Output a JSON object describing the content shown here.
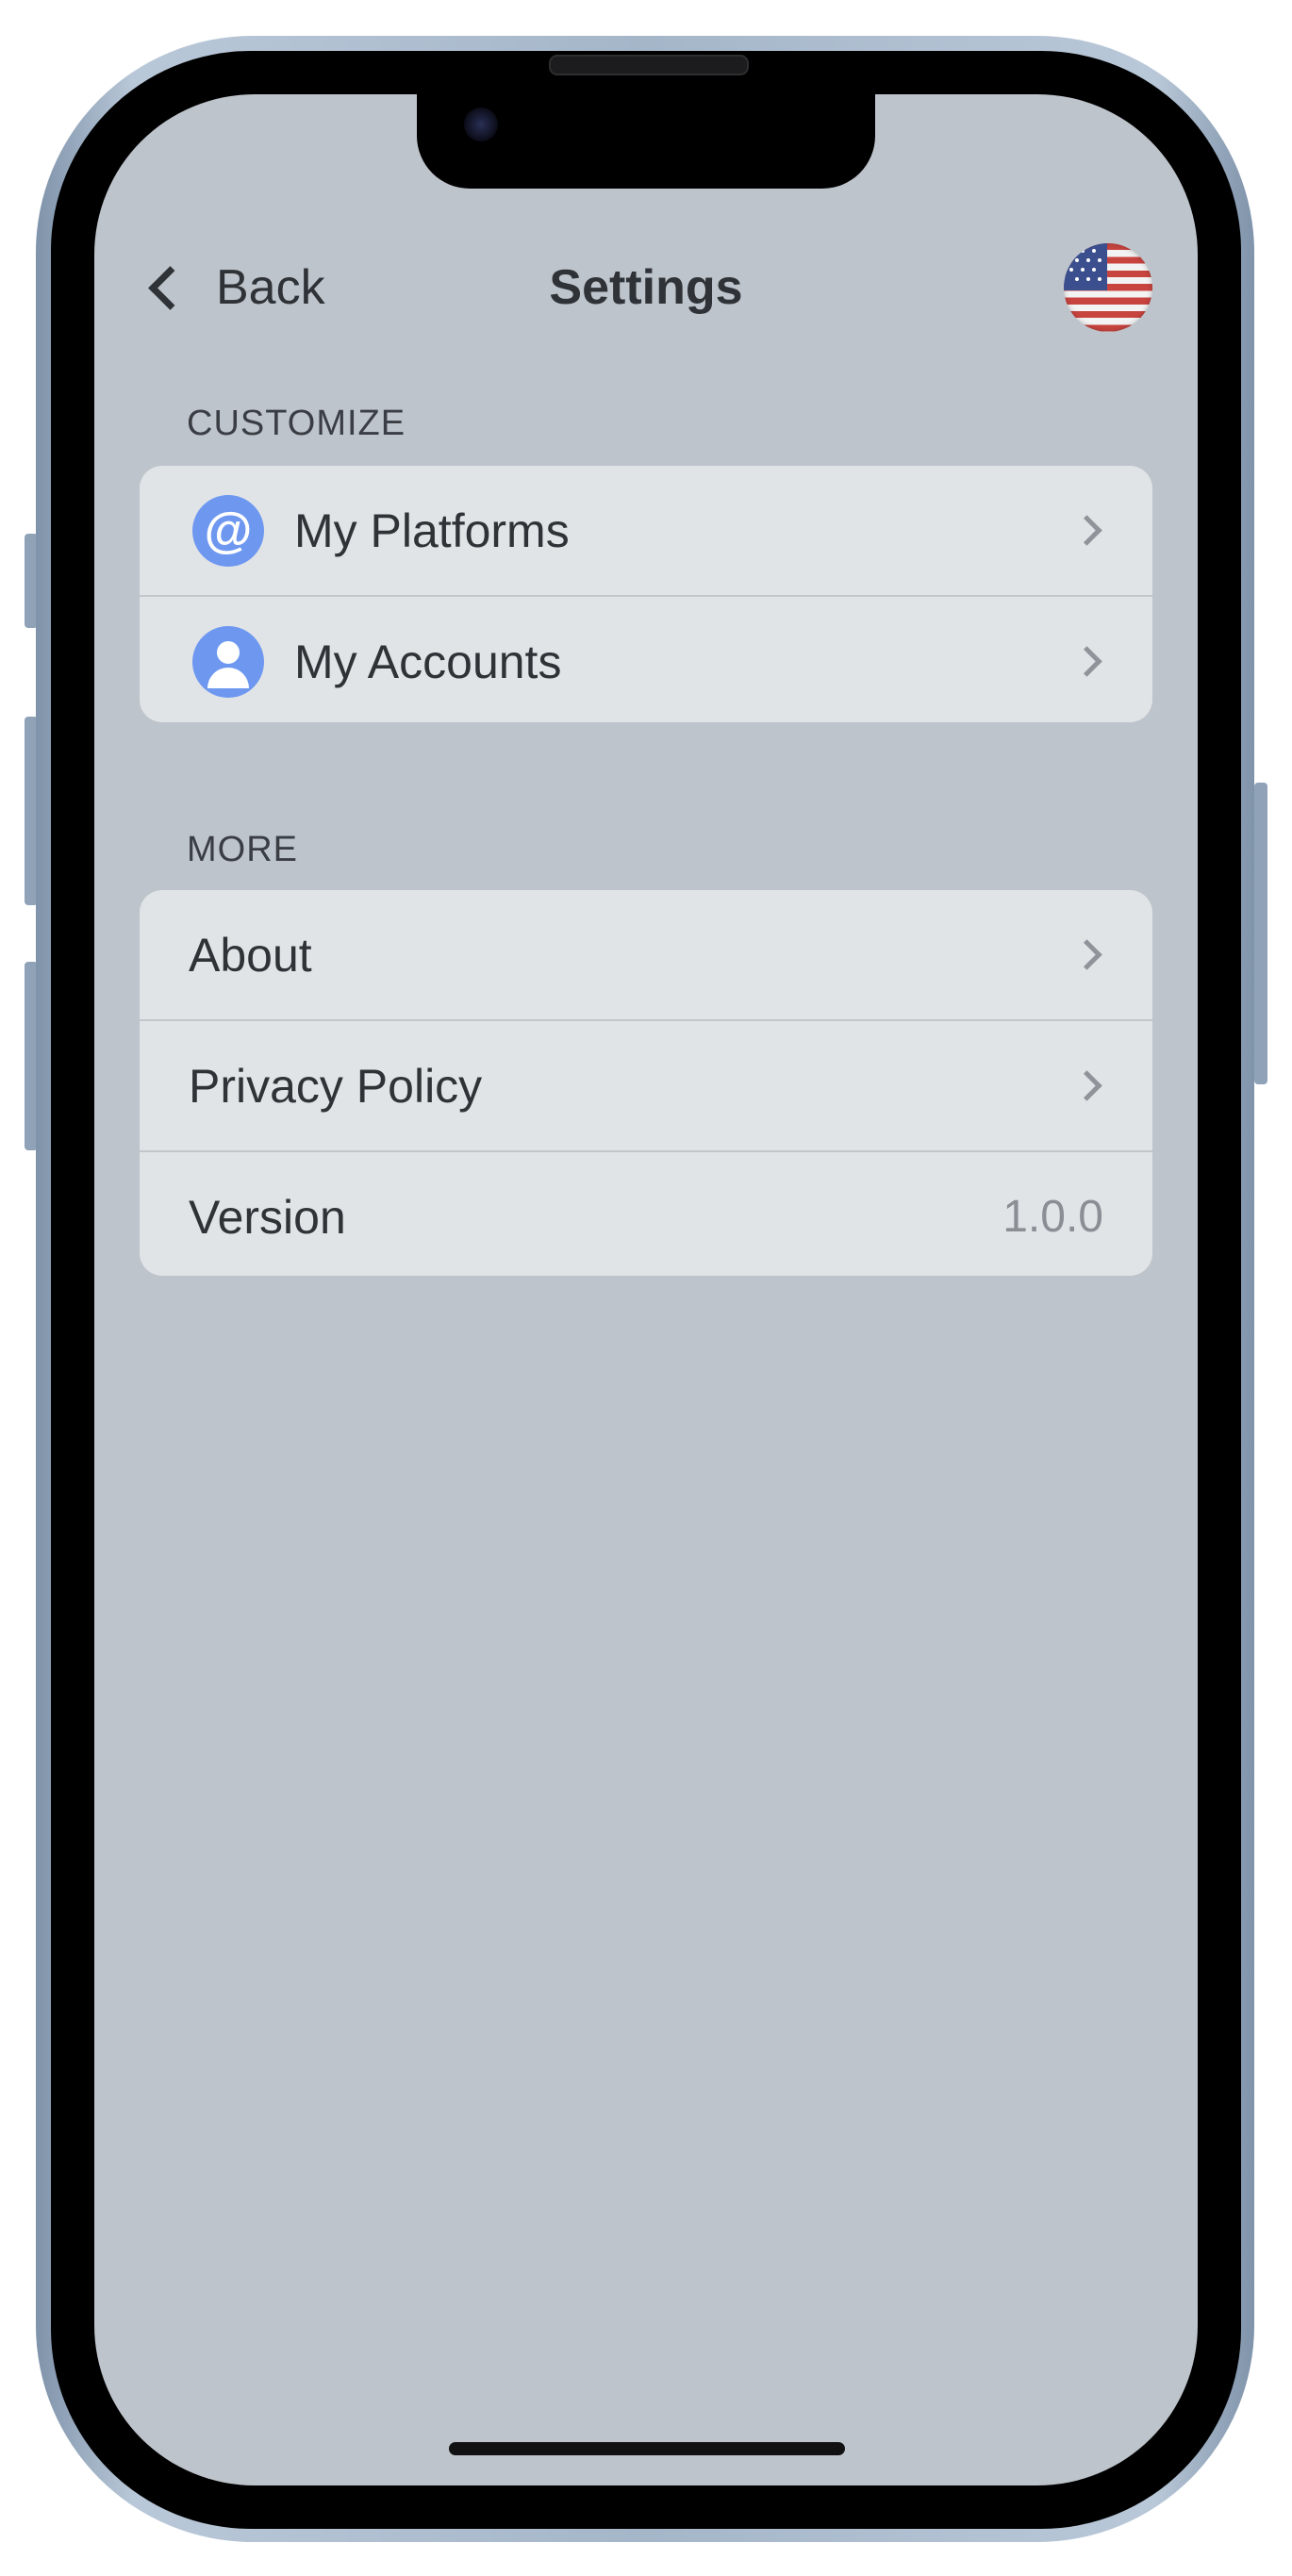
{
  "nav": {
    "back_label": "Back",
    "title": "Settings",
    "flag_icon": "us-flag-icon"
  },
  "sections": {
    "customize": {
      "header": "CUSTOMIZE",
      "items": [
        {
          "label": "My Platforms",
          "icon": "at-sign-icon"
        },
        {
          "label": "My Accounts",
          "icon": "person-icon"
        }
      ]
    },
    "more": {
      "header": "MORE",
      "items": [
        {
          "label": "About"
        },
        {
          "label": "Privacy Policy"
        },
        {
          "label": "Version",
          "value": "1.0.0"
        }
      ]
    }
  },
  "colors": {
    "background": "#bec4cb",
    "card": "#e1e4e7",
    "accent_icon": "#6e98f0",
    "text": "#2f3338",
    "secondary_text": "#8a8f96"
  }
}
